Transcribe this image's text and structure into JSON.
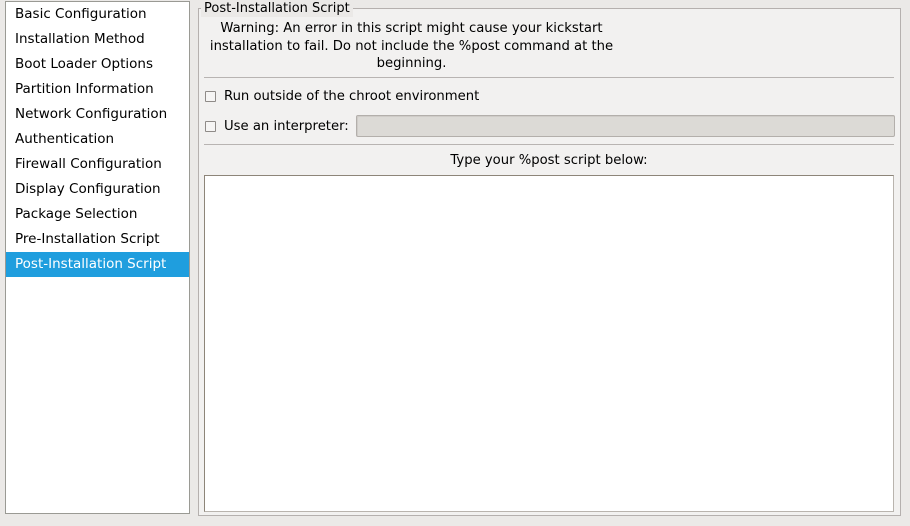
{
  "sidebar": {
    "items": [
      {
        "label": "Basic Configuration",
        "selected": false
      },
      {
        "label": "Installation Method",
        "selected": false
      },
      {
        "label": "Boot Loader Options",
        "selected": false
      },
      {
        "label": "Partition Information",
        "selected": false
      },
      {
        "label": "Network Configuration",
        "selected": false
      },
      {
        "label": "Authentication",
        "selected": false
      },
      {
        "label": "Firewall Configuration",
        "selected": false
      },
      {
        "label": "Display Configuration",
        "selected": false
      },
      {
        "label": "Package Selection",
        "selected": false
      },
      {
        "label": "Pre-Installation Script",
        "selected": false
      },
      {
        "label": "Post-Installation Script",
        "selected": true
      }
    ],
    "selected_label": "Post-Installation Script",
    "selection_color": "#1f9ede"
  },
  "panel": {
    "group_label": "Post-Installation Script",
    "warning_line1": "Warning: An error in this script might cause your kickstart",
    "warning_line2": "installation to fail. Do not include the %post command at the",
    "warning_line3": "beginning.",
    "chroot_checkbox_label": "Run outside of the chroot environment",
    "chroot_checkbox_checked": "false",
    "interpreter_checkbox_label": "Use an interpreter:",
    "interpreter_checkbox_checked": "false",
    "interpreter_value": "",
    "interpreter_placeholder": "",
    "interpreter_enabled": "false",
    "script_label": "Type your %post script below:",
    "script_value": "",
    "script_placeholder": ""
  },
  "colors": {
    "window_background": "#ebe9e7",
    "panel_background": "#f2f1f0",
    "list_background": "#ffffff",
    "accent": "#1f9ede",
    "border": "#b5b0ae",
    "disabled_field": "#dcdad6"
  }
}
